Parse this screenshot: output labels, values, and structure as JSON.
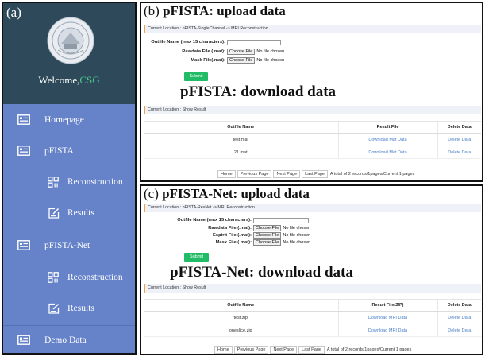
{
  "sidebar": {
    "panel_label": "(a)",
    "welcome_prefix": "Welcome,",
    "welcome_user": "CSG",
    "items": {
      "home": {
        "label": "Homepage"
      },
      "pfista": {
        "label": "pFISTA"
      },
      "pfista_recon": {
        "label": "Reconstruction"
      },
      "pfista_results": {
        "label": "Results"
      },
      "net": {
        "label": "pFISTA-Net"
      },
      "net_recon": {
        "label": "Reconstruction"
      },
      "net_results": {
        "label": "Results"
      },
      "demo": {
        "label": "Demo Data"
      }
    },
    "colors": {
      "nav_bg": "#6683c9",
      "header_bg": "#2e4a5a",
      "username": "#49c98f"
    }
  },
  "panel_b": {
    "label": "(b)",
    "title": "pFISTA: upload data",
    "breadcrumb": "Current Location : pFISTA-SingleChannel -> MRI Reconstruction",
    "form": {
      "name_label": "Outfile Name (max 15 characters):",
      "name_value": "",
      "rawdata_label": "Rawdata File (.mat):",
      "mask_label": "Mask File(.mat):",
      "choose_file": "Choose File",
      "no_file": "No file chosen",
      "submit": "Submit"
    },
    "download_title": "pFISTA: download data",
    "result_breadcrumb": "Current Location : Show Result",
    "table": {
      "headers": [
        "Outfile Name",
        "Result File",
        "Delete Data"
      ],
      "rows": [
        {
          "name": "test.mat",
          "file": "Download Mat Data",
          "del": "Delete Data"
        },
        {
          "name": "21.mat",
          "file": "Download Mat Data",
          "del": "Delete Data"
        }
      ]
    },
    "pager": {
      "home": "Home",
      "prev": "Previous Page",
      "next": "Next Page",
      "last": "Last Page",
      "summary": "A total of 2 records/1pages/Current 1 pages"
    }
  },
  "panel_c": {
    "label": "(c)",
    "title": "pFISTA-Net: upload data",
    "breadcrumb": "Current Location : pFISTA-ResNet -> MRI Reconstruction",
    "form": {
      "name_label": "Outfile Name (max 15 characters):",
      "name_value": "",
      "rawdata_label": "Rawdata File (.mat):",
      "espirit_label": "Espirit File (.mat):",
      "mask_label": "Mask File (.mat):",
      "choose_file": "Choose File",
      "no_file": "No file chosen",
      "submit": "Submit"
    },
    "download_title": "pFISTA-Net: download data",
    "result_breadcrumb": "Current Location : Show Result",
    "table": {
      "headers": [
        "Outfile Name",
        "Result File(ZIP)",
        "Delete Data"
      ],
      "rows": [
        {
          "name": "test.zip",
          "file": "Download MRI Data",
          "del": "Delete Data"
        },
        {
          "name": "oneslice.zip",
          "file": "Download MRI Data",
          "del": "Delete Data"
        }
      ]
    },
    "pager": {
      "home": "Home",
      "prev": "Previous Page",
      "next": "Next Page",
      "last": "Last Page",
      "summary": "A total of 2 records/1pages/Current 1 pages"
    }
  },
  "icons": {
    "home": "id-card-icon",
    "pfista": "id-card-icon",
    "reconstruction": "grid-icon",
    "results": "edit-icon",
    "demo": "id-card-icon",
    "seal": "university-seal-icon"
  }
}
